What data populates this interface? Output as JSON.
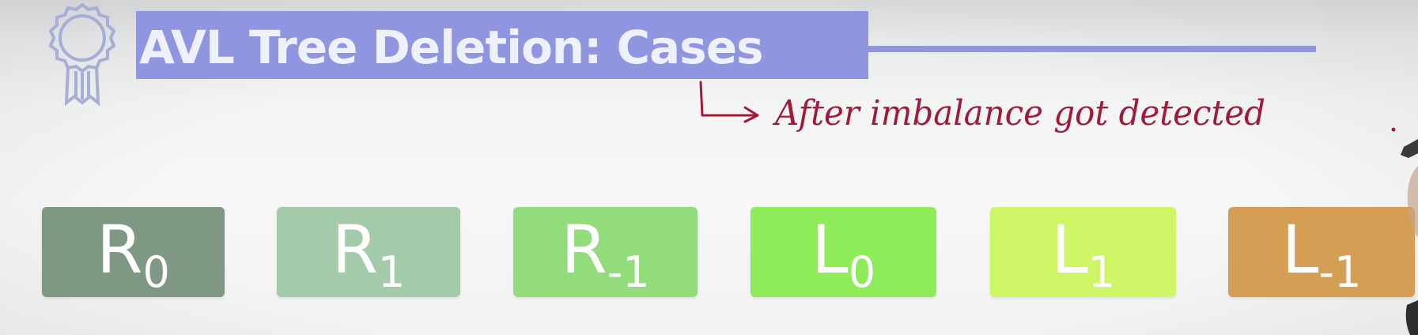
{
  "title": "AVL Tree Deletion: Cases",
  "annotation": {
    "text": "After imbalance got detected"
  },
  "icons": {
    "badge": "award-ribbon-icon",
    "arrow": "hooked-right-arrow-icon"
  },
  "colors": {
    "title_highlight": "#8f95de",
    "annotation_ink": "#a01a3a"
  },
  "cases": [
    {
      "letter": "R",
      "subscript": "0",
      "color": "#7e9883"
    },
    {
      "letter": "R",
      "subscript": "1",
      "color": "#a3cba9"
    },
    {
      "letter": "R",
      "subscript": "-1",
      "color": "#93dc7b"
    },
    {
      "letter": "L",
      "subscript": "0",
      "color": "#8fec59"
    },
    {
      "letter": "L",
      "subscript": "1",
      "color": "#cef565"
    },
    {
      "letter": "L",
      "subscript": "-1",
      "color": "#d49e55"
    }
  ]
}
